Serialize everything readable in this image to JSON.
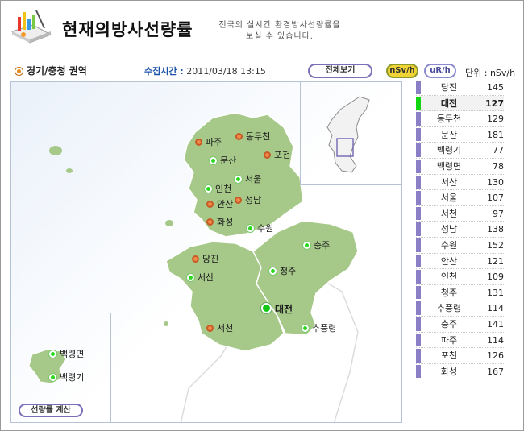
{
  "header": {
    "title": "현재의방사선량률",
    "subtitle_line1": "전국의 실시간 환경방사선량률을",
    "subtitle_line2": "보실 수 있습니다."
  },
  "toolbar": {
    "region": "경기/충청 권역",
    "collect_label": "수집시간 :",
    "collect_time": "2011/03/18 13:15",
    "view_all": "전체보기",
    "unit_nsv": "nSv/h",
    "unit_ur": "uR/h",
    "unit_text": "단위 : nSv/h"
  },
  "map": {
    "calc_button": "선량률 계산",
    "cities": [
      {
        "name": "파주",
        "type": "orange"
      },
      {
        "name": "동두천",
        "type": "orange"
      },
      {
        "name": "문산",
        "type": "green"
      },
      {
        "name": "포천",
        "type": "orange"
      },
      {
        "name": "서울",
        "type": "green"
      },
      {
        "name": "인천",
        "type": "green"
      },
      {
        "name": "성남",
        "type": "orange"
      },
      {
        "name": "안산",
        "type": "orange"
      },
      {
        "name": "화성",
        "type": "orange"
      },
      {
        "name": "수원",
        "type": "green"
      },
      {
        "name": "충주",
        "type": "green"
      },
      {
        "name": "당진",
        "type": "orange"
      },
      {
        "name": "청주",
        "type": "green"
      },
      {
        "name": "서산",
        "type": "green"
      },
      {
        "name": "대전",
        "type": "big"
      },
      {
        "name": "서천",
        "type": "orange"
      },
      {
        "name": "추풍령",
        "type": "green"
      },
      {
        "name": "백령면",
        "type": "green"
      },
      {
        "name": "백령기",
        "type": "green"
      }
    ]
  },
  "readings": [
    {
      "name": "당진",
      "value": "145"
    },
    {
      "name": "대전",
      "value": "127",
      "active": true
    },
    {
      "name": "동두천",
      "value": "129"
    },
    {
      "name": "문산",
      "value": "181"
    },
    {
      "name": "백령기",
      "value": "77"
    },
    {
      "name": "백령면",
      "value": "78"
    },
    {
      "name": "서산",
      "value": "130"
    },
    {
      "name": "서울",
      "value": "107"
    },
    {
      "name": "서천",
      "value": "97"
    },
    {
      "name": "성남",
      "value": "138"
    },
    {
      "name": "수원",
      "value": "152"
    },
    {
      "name": "안산",
      "value": "121"
    },
    {
      "name": "인천",
      "value": "109"
    },
    {
      "name": "청주",
      "value": "131"
    },
    {
      "name": "추풍령",
      "value": "114"
    },
    {
      "name": "충주",
      "value": "141"
    },
    {
      "name": "파주",
      "value": "114"
    },
    {
      "name": "포천",
      "value": "126"
    },
    {
      "name": "화성",
      "value": "167"
    }
  ],
  "colors": {
    "land": "#a6c98a",
    "active_bar": "#12d612",
    "list_bar": "#8a7fc4",
    "accent_button": "#f0d335"
  }
}
